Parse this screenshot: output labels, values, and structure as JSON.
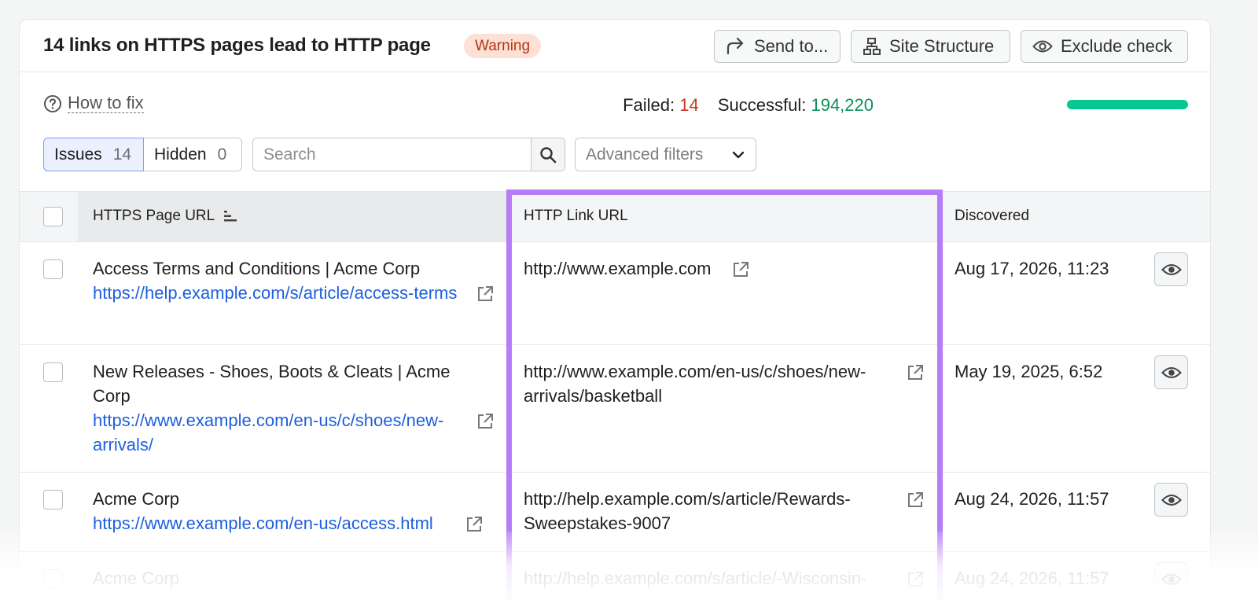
{
  "header": {
    "title": "14 links on HTTPS pages lead to HTTP page",
    "badge": "Warning",
    "send_label": "Send to...",
    "site_label": "Site Structure",
    "exclude_label": "Exclude check"
  },
  "summary": {
    "how_to_fix": "How to fix",
    "failed_label": "Failed:",
    "failed_value": "14",
    "successful_label": "Successful:",
    "successful_value": "194,220",
    "success_fraction": 0.9999
  },
  "filters": {
    "issues_label": "Issues",
    "issues_count": "14",
    "hidden_label": "Hidden",
    "hidden_count": "0",
    "search_placeholder": "Search",
    "advanced_label": "Advanced filters"
  },
  "table": {
    "columns": [
      "HTTPS Page URL",
      "HTTP Link URL",
      "Discovered"
    ],
    "rows": [
      {
        "title": "Access Terms and Conditions | Acme Corp",
        "page_url": "https://help.example.com/s/article/access-terms",
        "http_url": "http://www.example.com",
        "discovered": "Aug 17, 2026, 11:23"
      },
      {
        "title": "New Releases - Shoes, Boots & Cleats | Acme Corp",
        "page_url": "https://www.example.com/en-us/c/shoes/new-arrivals/",
        "http_url": "http://www.example.com/en-us/c/shoes/new-arrivals/basketball",
        "discovered": "May 19, 2025, 6:52"
      },
      {
        "title": "Acme Corp",
        "page_url": "https://www.example.com/en-us/access.html",
        "http_url": "http://help.example.com/s/article/Rewards-Sweepstakes-9007",
        "discovered": "Aug 24, 2026, 11:57"
      },
      {
        "title": "Acme Corp",
        "page_url": "",
        "http_url": "http://help.example.com/s/article/-Wisconsin-",
        "discovered": "Aug 24, 2026, 11:57"
      }
    ]
  },
  "colors": {
    "accent_highlight": "#b77cf7",
    "failed": "#c5381d",
    "successful": "#0f8f5c",
    "progress": "#06c892",
    "link": "#1c5fde",
    "warning_bg": "#fde0d6"
  },
  "icons": {
    "send": "share-arrow-icon",
    "site": "site-structure-icon",
    "exclude": "eye-icon",
    "help": "question-circle-icon",
    "search": "search-icon",
    "dropdown": "chevron-down-icon",
    "sort": "sort-icon",
    "external": "external-link-icon"
  }
}
